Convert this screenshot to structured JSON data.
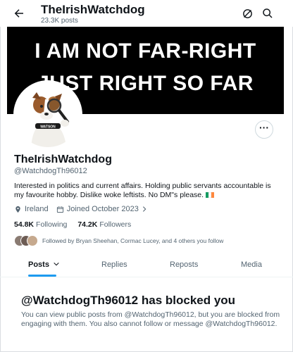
{
  "header": {
    "title": "TheIrishWatchdog",
    "posts_count": "23.3K posts"
  },
  "banner": {
    "line1": "I AM NOT FAR-RIGHT",
    "line2": "JUST RIGHT SO FAR"
  },
  "avatar": {
    "collar_text": "WATSON"
  },
  "profile": {
    "display_name": "TheIrishWatchdog",
    "handle": "@WatchdogTh96012",
    "bio": "Interested in politics and current affairs. Holding public servants accountable is my favourite hobby.  Dislike woke leftists.  No DM\"s please. ",
    "location": "Ireland",
    "joined": "Joined October 2023",
    "following_count": "54.8K",
    "following_label": "Following",
    "followers_count": "74.2K",
    "followers_label": "Followers",
    "followed_by": "Followed by Bryan Sheehan, Cormac Lucey, and 4 others you follow"
  },
  "tabs": [
    {
      "label": "Posts",
      "active": true
    },
    {
      "label": "Replies",
      "active": false
    },
    {
      "label": "Reposts",
      "active": false
    },
    {
      "label": "Media",
      "active": false
    }
  ],
  "blocked": {
    "title": "@WatchdogTh96012 has blocked you",
    "message": "You can view public posts from @WatchdogTh96012, but you are blocked from engaging with them. You also cannot follow or message @WatchdogTh96012."
  },
  "colors": {
    "accent": "#1d9bf0",
    "flag_green": "#169b62",
    "flag_white": "#ffffff",
    "flag_orange": "#ff883e"
  }
}
